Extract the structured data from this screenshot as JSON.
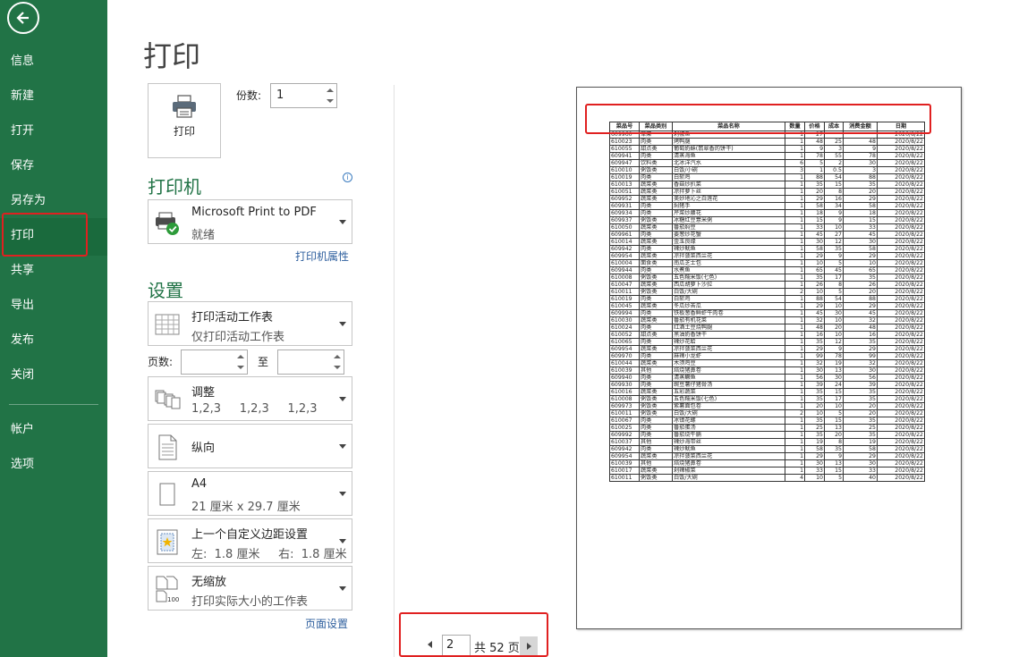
{
  "sidebar": {
    "items": [
      {
        "label": "信息",
        "key": "info"
      },
      {
        "label": "新建",
        "key": "new"
      },
      {
        "label": "打开",
        "key": "open"
      },
      {
        "label": "保存",
        "key": "save"
      },
      {
        "label": "另存为",
        "key": "save-as"
      },
      {
        "label": "打印",
        "key": "print"
      },
      {
        "label": "共享",
        "key": "share"
      },
      {
        "label": "导出",
        "key": "export"
      },
      {
        "label": "发布",
        "key": "publish"
      },
      {
        "label": "关闭",
        "key": "close"
      },
      {
        "label": "帐户",
        "key": "account"
      },
      {
        "label": "选项",
        "key": "options"
      }
    ],
    "active": "打印",
    "accent": "#217346"
  },
  "page_title": "打印",
  "print_button": {
    "label": "打印",
    "icon": "printer-icon"
  },
  "copies": {
    "label": "份数:",
    "value": "1"
  },
  "printer": {
    "heading": "打印机",
    "name": "Microsoft Print to PDF",
    "status": "就绪",
    "properties_link": "打印机属性",
    "info_icon": "i"
  },
  "settings": {
    "heading": "设置",
    "dropdowns": [
      {
        "line1": "打印活动工作表",
        "line2": "仅打印活动工作表",
        "icon": "sheet-icon"
      },
      {
        "line1": "调整",
        "line2": "1,2,3     1,2,3     1,2,3",
        "icon": "collate-icon"
      },
      {
        "line1": "纵向",
        "line2": "",
        "icon": "portrait-icon"
      },
      {
        "line1": "A4",
        "line2": "21 厘米 x 29.7 厘米",
        "icon": "paper-size-icon"
      },
      {
        "line1": "上一个自定义边距设置",
        "line2": "左:  1.8 厘米     右:  1.8 厘米",
        "icon": "margins-icon"
      },
      {
        "line1": "无缩放",
        "line2": "打印实际大小的工作表",
        "icon": "no-scaling-icon",
        "badge": "100"
      }
    ],
    "pages_label": "页数:",
    "pages_to": "至",
    "page_setup_link": "页面设置"
  },
  "pagination": {
    "current": "2",
    "total_text": "共 52 页"
  },
  "highlight_color": "#e02020",
  "preview": {
    "headers": [
      "菜品号",
      "菜品类别",
      "菜品名称",
      "数量",
      "价格",
      "成本",
      "消费金额",
      "日期"
    ],
    "rows": [
      [
        "609960",
        "荤菜",
        "剁椒鱼",
        "1",
        "27",
        "",
        "",
        "2020/8/22"
      ],
      [
        "610023",
        "肉类",
        "烤鸭腿",
        "1",
        "48",
        "25",
        "48",
        "2020/8/22"
      ],
      [
        "610055",
        "甜点类",
        "葡萄奶酥(翡翠香的饼干)",
        "1",
        "9",
        "3",
        "9",
        "2020/8/22"
      ],
      [
        "609941",
        "肉类",
        "清蒸海鱼",
        "1",
        "78",
        "55",
        "78",
        "2020/8/22"
      ],
      [
        "609947",
        "饮料类",
        "北冰洋汽水",
        "6",
        "5",
        "2",
        "30",
        "2020/8/22"
      ],
      [
        "610010",
        "粥饭类",
        "白饭/小碗",
        "3",
        "1",
        "0.5",
        "3",
        "2020/8/22"
      ],
      [
        "610019",
        "肉类",
        "白斩鸡",
        "1",
        "88",
        "54",
        "88",
        "2020/8/22"
      ],
      [
        "610013",
        "蔬菜类",
        "香菇炒扒菜",
        "1",
        "35",
        "15",
        "35",
        "2020/8/22"
      ],
      [
        "610051",
        "蔬菜类",
        "凉拌萝卜丝",
        "1",
        "20",
        "8",
        "20",
        "2020/8/22"
      ],
      [
        "609952",
        "蔬菜类",
        "美妙地沁之白莲花",
        "1",
        "29",
        "16",
        "29",
        "2020/8/22"
      ],
      [
        "609931",
        "肉类",
        "焖猪手",
        "1",
        "58",
        "34",
        "58",
        "2020/8/22"
      ],
      [
        "609934",
        "肉类",
        "芹菜炒腰花",
        "1",
        "18",
        "9",
        "18",
        "2020/8/22"
      ],
      [
        "609937",
        "粥饭类",
        "冰糖红豆薏米粥",
        "1",
        "15",
        "9",
        "15",
        "2020/8/22"
      ],
      [
        "610050",
        "蔬菜类",
        "番茄焖豆",
        "1",
        "33",
        "10",
        "33",
        "2020/8/22"
      ],
      [
        "609961",
        "肉类",
        "姜葱炒花蟹",
        "1",
        "45",
        "27",
        "45",
        "2020/8/22"
      ],
      [
        "610014",
        "蔬菜类",
        "金玉良缘",
        "1",
        "30",
        "12",
        "30",
        "2020/8/22"
      ],
      [
        "609942",
        "肉类",
        "辣炒鱿鱼",
        "1",
        "58",
        "35",
        "58",
        "2020/8/22"
      ],
      [
        "609954",
        "蔬菜类",
        "凉拌菠菜西兰花",
        "1",
        "29",
        "9",
        "29",
        "2020/8/22"
      ],
      [
        "610004",
        "面食类",
        "南瓜芝士包",
        "1",
        "10",
        "5",
        "10",
        "2020/8/22"
      ],
      [
        "609944",
        "肉类",
        "水煮鱼",
        "1",
        "65",
        "45",
        "65",
        "2020/8/22"
      ],
      [
        "610008",
        "粥饭类",
        "五色糯米饭(七色)",
        "1",
        "35",
        "17",
        "35",
        "2020/8/22"
      ],
      [
        "610047",
        "蔬菜类",
        "西瓜胡萝卜沙拉",
        "1",
        "26",
        "8",
        "26",
        "2020/8/22"
      ],
      [
        "610011",
        "粥饭类",
        "白饭/大碗",
        "2",
        "10",
        "5",
        "20",
        "2020/8/22"
      ],
      [
        "610019",
        "肉类",
        "白斩鸡",
        "1",
        "88",
        "54",
        "88",
        "2020/8/22"
      ],
      [
        "610045",
        "蔬菜类",
        "冬瓜炒苦瓜",
        "1",
        "29",
        "10",
        "29",
        "2020/8/22"
      ],
      [
        "609994",
        "肉类",
        "铁板葱香鲜虾牛肉卷",
        "1",
        "45",
        "30",
        "45",
        "2020/8/22"
      ],
      [
        "610030",
        "蔬菜类",
        "番茄有机花菜",
        "1",
        "32",
        "10",
        "32",
        "2020/8/22"
      ],
      [
        "610024",
        "肉类",
        "红酒土豆烧鸭腿",
        "1",
        "48",
        "20",
        "48",
        "2020/8/22"
      ],
      [
        "610052",
        "甜点类",
        "黑油奶香饼干",
        "1",
        "16",
        "10",
        "16",
        "2020/8/22"
      ],
      [
        "610065",
        "肉类",
        "辣炒花蛤",
        "1",
        "35",
        "12",
        "35",
        "2020/8/22"
      ],
      [
        "609954",
        "蔬菜类",
        "凉拌菠菜西兰花",
        "1",
        "29",
        "9",
        "29",
        "2020/8/22"
      ],
      [
        "609970",
        "肉类",
        "麻辣小龙虾",
        "1",
        "99",
        "78",
        "99",
        "2020/8/22"
      ],
      [
        "610044",
        "蔬菜类",
        "木须鸡豆",
        "1",
        "32",
        "19",
        "32",
        "2020/8/22"
      ],
      [
        "610039",
        "其他",
        "焙烧猪鼻卷",
        "1",
        "30",
        "13",
        "30",
        "2020/8/22"
      ],
      [
        "609940",
        "肉类",
        "清蒸鳜鱼",
        "1",
        "56",
        "30",
        "56",
        "2020/8/22"
      ],
      [
        "609930",
        "肉类",
        "豌豆薯仔猪骨汤",
        "1",
        "39",
        "24",
        "39",
        "2020/8/22"
      ],
      [
        "610016",
        "蔬菜类",
        "五彩蔬菜",
        "1",
        "35",
        "15",
        "35",
        "2020/8/22"
      ],
      [
        "610008",
        "粥饭类",
        "五色糯米饭(七色)",
        "1",
        "35",
        "17",
        "35",
        "2020/8/22"
      ],
      [
        "609973",
        "粥饭类",
        "紫薯面包卷",
        "1",
        "20",
        "10",
        "20",
        "2020/8/22"
      ],
      [
        "610011",
        "粥饭类",
        "白饭/大碗",
        "2",
        "10",
        "5",
        "20",
        "2020/8/22"
      ],
      [
        "610067",
        "肉类",
        "冰镇花螺",
        "1",
        "35",
        "15",
        "35",
        "2020/8/22"
      ],
      [
        "610025",
        "肉类",
        "番茄蛋汤",
        "1",
        "25",
        "13",
        "25",
        "2020/8/22"
      ],
      [
        "609992",
        "肉类",
        "番茄烧牛腩",
        "1",
        "35",
        "20",
        "35",
        "2020/8/22"
      ],
      [
        "610037",
        "其他",
        "辣炒海带丝",
        "1",
        "19",
        "8",
        "19",
        "2020/8/22"
      ],
      [
        "609942",
        "肉类",
        "辣炒鱿鱼",
        "1",
        "58",
        "35",
        "58",
        "2020/8/22"
      ],
      [
        "609954",
        "蔬菜类",
        "凉拌菠菜西兰花",
        "1",
        "29",
        "9",
        "29",
        "2020/8/22"
      ],
      [
        "610039",
        "其他",
        "焙烧猪鼻卷",
        "1",
        "30",
        "13",
        "30",
        "2020/8/22"
      ],
      [
        "610017",
        "蔬菜类",
        "剁辣椒菜",
        "1",
        "33",
        "15",
        "33",
        "2020/8/22"
      ],
      [
        "610011",
        "粥饭类",
        "白饭/大碗",
        "4",
        "10",
        "5",
        "40",
        "2020/8/22"
      ]
    ]
  }
}
